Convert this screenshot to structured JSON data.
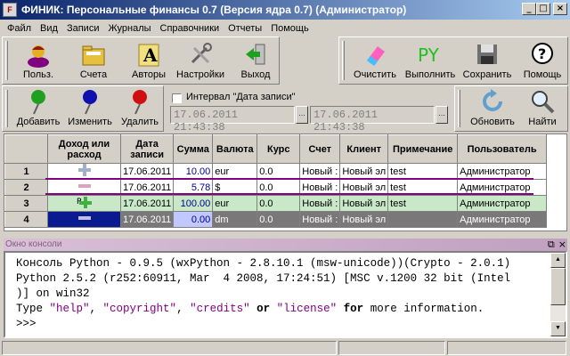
{
  "window": {
    "title": "ФИНИК: Персональные финансы 0.7 (Версия ядра 0.7) (Администратор)",
    "app_icon_text": "F",
    "controls": {
      "minimize": "_",
      "maximize": "□",
      "close": "×"
    }
  },
  "menu": [
    "Файл",
    "Вид",
    "Записи",
    "Журналы",
    "Справочники",
    "Отчеты",
    "Помощь"
  ],
  "toolbar_main": [
    {
      "label": "Польз.",
      "icon": "user-icon"
    },
    {
      "label": "Счета",
      "icon": "folder-icon"
    },
    {
      "label": "Авторы",
      "icon": "font-icon"
    },
    {
      "label": "Настройки",
      "icon": "tools-icon"
    },
    {
      "label": "Выход",
      "icon": "exit-icon"
    }
  ],
  "toolbar_right": [
    {
      "label": "Очистить",
      "icon": "eraser-icon"
    },
    {
      "label": "Выполнить",
      "icon": "run-icon"
    },
    {
      "label": "Сохранить",
      "icon": "save-icon"
    },
    {
      "label": "Помощь",
      "icon": "help-icon"
    }
  ],
  "toolbar_records": [
    {
      "label": "Добавить",
      "icon": "pin-green-icon"
    },
    {
      "label": "Изменить",
      "icon": "pin-blue-icon"
    },
    {
      "label": "Удалить",
      "icon": "pin-red-icon"
    }
  ],
  "interval": {
    "label": "Интервал \"Дата записи\"",
    "checked": false,
    "from": "17.06.2011 21:43:38",
    "to": "17.06.2011 21:43:38",
    "picker_glyph": "…"
  },
  "toolbar_search": [
    {
      "label": "Обновить",
      "icon": "refresh-icon"
    },
    {
      "label": "Найти",
      "icon": "search-icon"
    }
  ],
  "grid": {
    "columns": [
      "Доход или расход",
      "Дата записи",
      "Сумма",
      "Валюта",
      "Курс",
      "Счет",
      "Клиент",
      "Примечание",
      "Пользователь"
    ],
    "rows": [
      {
        "n": "1",
        "type": "plus",
        "date": "17.06.2011",
        "sum": "10.00",
        "cur": "eur",
        "rate": "0.0",
        "acc": "Новый :",
        "client": "Новый эл",
        "note": "test",
        "user": "Администратор"
      },
      {
        "n": "2",
        "type": "minus",
        "date": "17.06.2011",
        "sum": "5.78",
        "cur": "$",
        "rate": "0.0",
        "acc": "Новый :",
        "client": "Новый эл",
        "note": "test",
        "user": "Администратор"
      },
      {
        "n": "3",
        "type": "plus-p",
        "date": "17.06.2011",
        "sum": "100.00",
        "cur": "eur",
        "rate": "0.0",
        "acc": "Новый :",
        "client": "Новый эл",
        "note": "test",
        "user": "Администратор"
      },
      {
        "n": "4",
        "type": "minus",
        "date": "17.06.2011",
        "sum": "0.00",
        "cur": "dm",
        "rate": "0.0",
        "acc": "Новый :",
        "client": "Новый эл",
        "note": "",
        "user": "Администратор"
      }
    ]
  },
  "console": {
    "title": "Окно консоли",
    "ctrl_restore": "⧉",
    "ctrl_close": "×",
    "line1": "Консоль Python - 0.9.5 (wxPython - 2.8.10.1 (msw-unicode))(Crypto - 2.0.1)",
    "line2": "Python 2.5.2 (r252:60911, Mar  4 2008, 17:24:51) [MSC v.1200 32 bit (Intel",
    "line3": ")] on win32",
    "line4_prefix": "Type ",
    "kw1": "\"help\"",
    "sep1": ", ",
    "kw2": "\"copyright\"",
    "sep2": ", ",
    "kw3": "\"credits\"",
    "sep3": " ",
    "or": "or",
    "sep4": " ",
    "kw4": "\"license\"",
    "sep5": " ",
    "for": "for",
    "rest": " more information.",
    "prompt": ">>> "
  }
}
